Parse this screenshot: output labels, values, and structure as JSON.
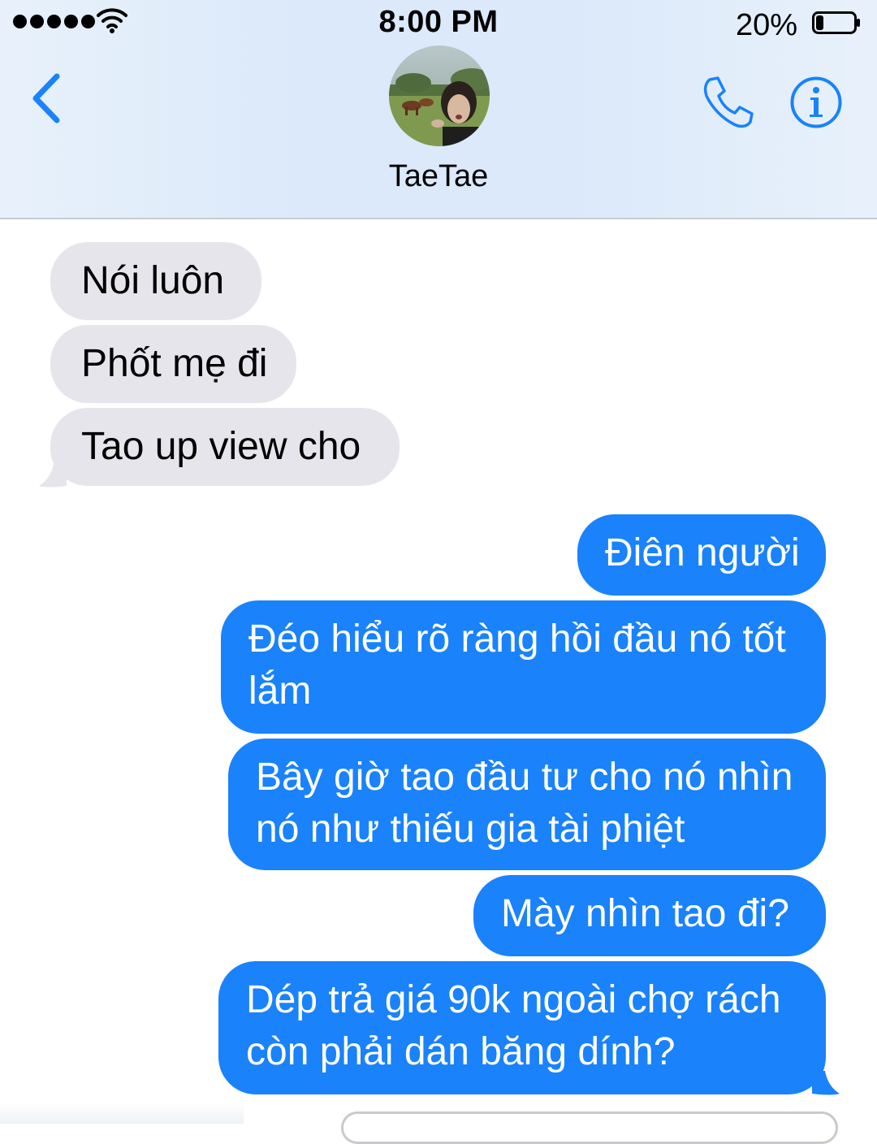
{
  "status_bar": {
    "time": "8:00 PM",
    "battery_percent": "20%",
    "battery_level": 0.2,
    "signal_bars": 5
  },
  "conversation": {
    "contact_name": "TaeTae"
  },
  "messages": [
    {
      "direction": "incoming",
      "text": "Nói luôn"
    },
    {
      "direction": "incoming",
      "text": "Phốt mẹ đi"
    },
    {
      "direction": "incoming",
      "text": "Tao up view cho"
    },
    {
      "direction": "outgoing",
      "text": "Điên người"
    },
    {
      "direction": "outgoing",
      "lines": [
        "Đéo hiểu rõ ràng hồi đầu nó tốt",
        "lắm"
      ]
    },
    {
      "direction": "outgoing",
      "lines": [
        "Bây giờ tao đầu tư cho nó nhìn",
        "nó như thiếu gia tài phiệt"
      ]
    },
    {
      "direction": "outgoing",
      "text": "Mày nhìn tao đi?"
    },
    {
      "direction": "outgoing",
      "lines": [
        "Dép trả giá 90k ngoài chợ rách",
        "còn phải dán băng dính?"
      ]
    }
  ],
  "colors": {
    "accent": "#1a82fb",
    "incoming_bubble": "#e6e5eb",
    "header_bg": "#dbe9fa"
  },
  "icons": {
    "back": "chevron-left-icon",
    "phone": "phone-icon",
    "info": "info-icon",
    "wifi": "wifi-icon",
    "battery": "battery-icon"
  }
}
